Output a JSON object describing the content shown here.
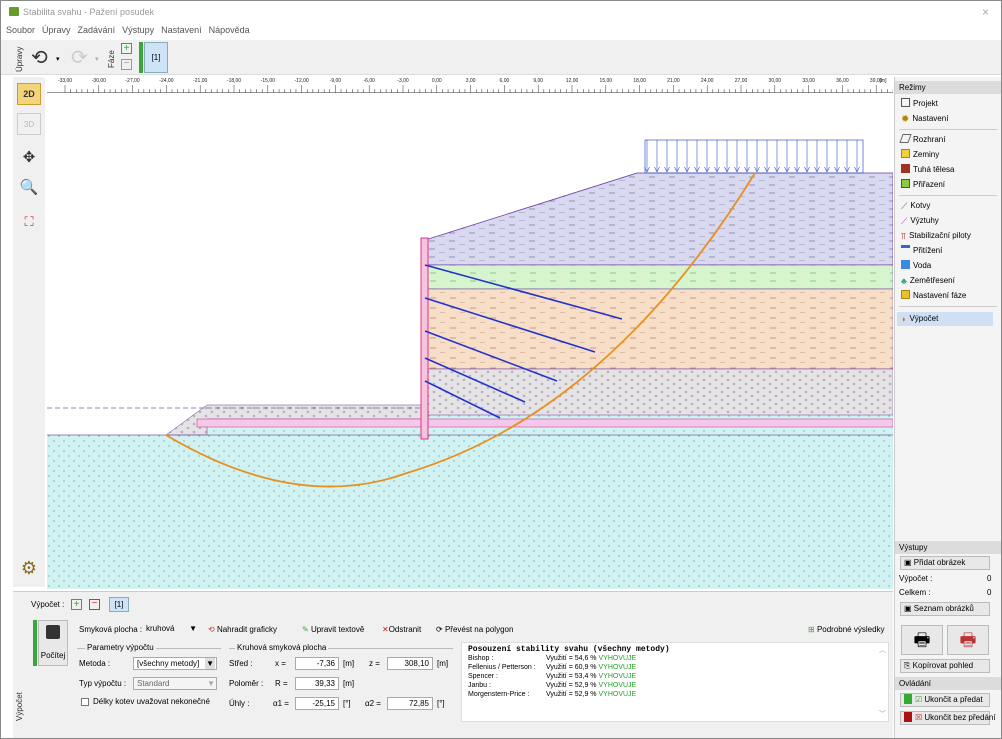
{
  "window": {
    "title": "Stabilita svahu - Pažení posudek",
    "close": "×"
  },
  "menu": [
    "Soubor",
    "Úpravy",
    "Zadávání",
    "Výstupy",
    "Nastavení",
    "Nápověda"
  ],
  "toolbar": {
    "edits_label": "Úpravy",
    "phase_label": "Fáze",
    "phase_value": "[1]"
  },
  "left_tools": {
    "mode_2d": "2D",
    "mode_3d": "3D"
  },
  "ruler": {
    "unit": "[m]",
    "ticks": [
      "-33,00",
      "-30,00",
      "-27,00",
      "-24,00",
      "-21,00",
      "-18,00",
      "-15,00",
      "-12,00",
      "-9,00",
      "-6,00",
      "-3,00",
      "0,00",
      "3,00",
      "6,00",
      "9,00",
      "12,00",
      "15,00",
      "18,00",
      "21,00",
      "24,00",
      "27,00",
      "30,00",
      "33,00",
      "36,00",
      "39,00"
    ]
  },
  "modes": {
    "header": "Režimy",
    "items": [
      "Projekt",
      "Nastavení",
      "Rozhraní",
      "Zeminy",
      "Tuhá tělesa",
      "Přiřazení",
      "Kotvy",
      "Výztuhy",
      "Stabilizační piloty",
      "Přitížení",
      "Voda",
      "Zemětřesení",
      "Nastavení fáze",
      "Výpočet"
    ],
    "active": "Výpočet"
  },
  "outputs": {
    "header": "Výstupy",
    "add_image": "Přidat obrázek",
    "calc_label": "Výpočet :",
    "calc_value": "0",
    "total_label": "Celkem :",
    "total_value": "0",
    "image_list": "Seznam obrázků",
    "copy_view": "Kopírovat pohled"
  },
  "control": {
    "header": "Ovládání",
    "finish_pass": "Ukončit a předat",
    "finish_no_pass": "Ukončit bez předání"
  },
  "bottom": {
    "side_label": "Výpočet",
    "calc_label": "Výpočet :",
    "calc_value": "[1]",
    "run_button": "Počítej",
    "slip_surface_label": "Smyková plocha :",
    "slip_surface_value": "kruhová",
    "replace_graphic": "Nahradit graficky",
    "edit_text": "Upravit textově",
    "remove": "Odstranit",
    "to_polygon": "Převést na polygon",
    "detailed_results": "Podrobné výsledky",
    "params_group": "Parametry výpočtu",
    "method_label": "Metoda :",
    "method_value": "[všechny metody]",
    "calc_type_label": "Typ výpočtu :",
    "calc_type_value": "Standard",
    "anchor_check": "Délky kotev uvažovat nekonečné",
    "circle_group": "Kruhová smyková plocha",
    "center_label": "Střed :",
    "x_label": "x =",
    "x_value": "-7,36",
    "z_label": "z =",
    "z_value": "308,10",
    "unit_m": "[m]",
    "radius_label": "Poloměr :",
    "r_label": "R =",
    "r_value": "39,33",
    "angles_label": "Úhly :",
    "a1_label": "α1 =",
    "a1_value": "-25,15",
    "a2_label": "α2 =",
    "a2_value": "72,85",
    "unit_deg": "[°]"
  },
  "results": {
    "title": "Posouzení stability svahu (všechny metody)",
    "rows": [
      {
        "method": "Bishop :",
        "usage": "Využití = 54,6 %",
        "status": "VYHOVUJE"
      },
      {
        "method": "Fellenius / Petterson :",
        "usage": "Využití = 60,9 %",
        "status": "VYHOVUJE"
      },
      {
        "method": "Spencer :",
        "usage": "Využití = 53,4 %",
        "status": "VYHOVUJE"
      },
      {
        "method": "Janbu :",
        "usage": "Využití = 52,9 %",
        "status": "VYHOVUJE"
      },
      {
        "method": "Morgenstern-Price :",
        "usage": "Využití = 52,9 %",
        "status": "VYHOVUJE"
      }
    ]
  },
  "colors": {
    "accent": "#3aa63a",
    "pass": "#2aa02a",
    "slip_line": "#e8901e",
    "anchor": "#2233cc",
    "wall": "#e0308c"
  }
}
